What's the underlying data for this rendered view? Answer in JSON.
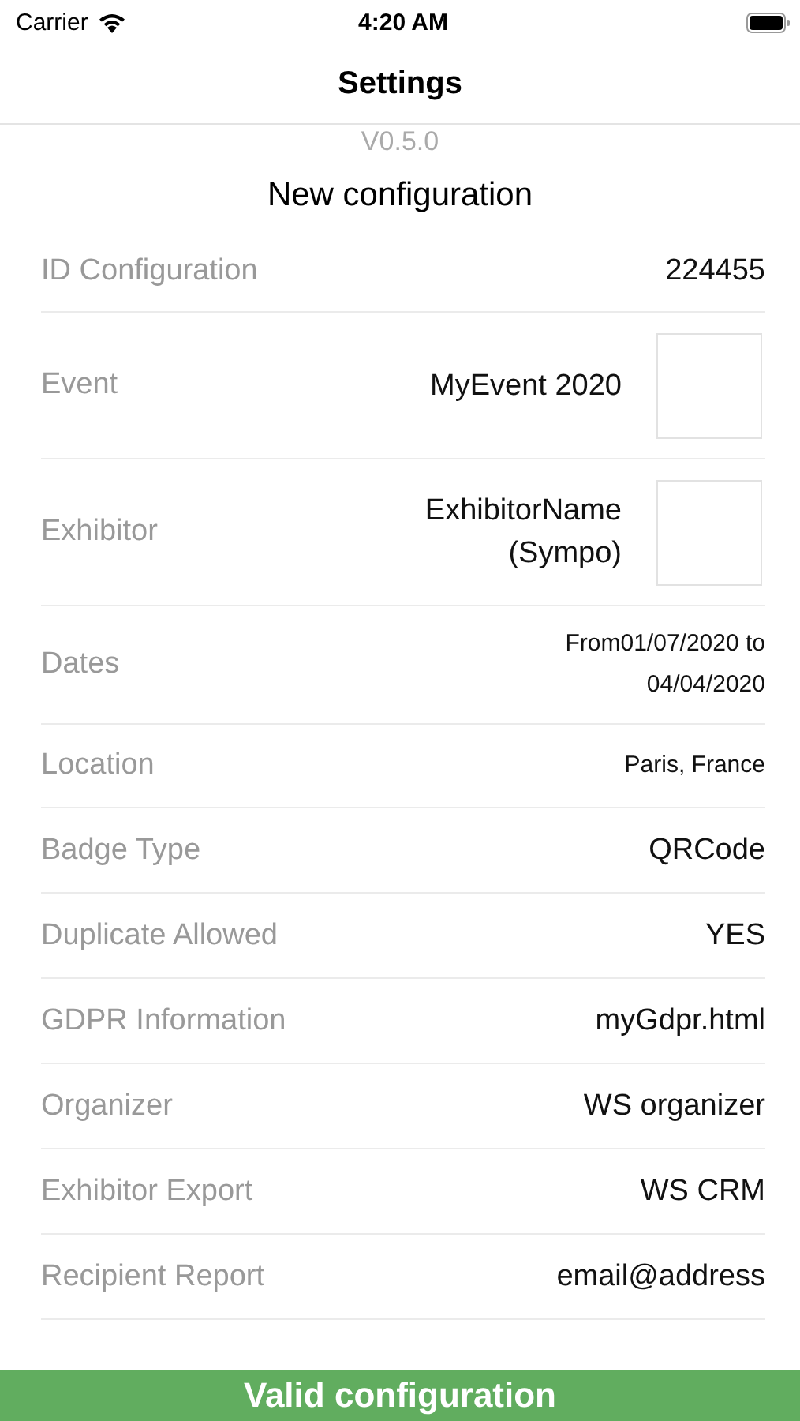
{
  "status_bar": {
    "carrier": "Carrier",
    "time": "4:20 AM"
  },
  "nav": {
    "title": "Settings"
  },
  "version": "V0.5.0",
  "section_title": "New configuration",
  "rows": [
    {
      "kind": "text",
      "label": "ID Configuration",
      "value": "224455"
    },
    {
      "kind": "image",
      "label": "Event",
      "value": "MyEvent 2020"
    },
    {
      "kind": "image",
      "label": "Exhibitor",
      "value": "ExhibitorName (Sympo)"
    },
    {
      "kind": "small",
      "label": "Dates",
      "value": "From01/07/2020 to 04/04/2020"
    },
    {
      "kind": "small",
      "label": "Location",
      "value": "Paris, France"
    },
    {
      "kind": "text",
      "label": "Badge Type",
      "value": "QRCode"
    },
    {
      "kind": "text",
      "label": "Duplicate Allowed",
      "value": "YES"
    },
    {
      "kind": "text",
      "label": "GDPR Information",
      "value": "myGdpr.html"
    },
    {
      "kind": "text",
      "label": "Organizer",
      "value": "WS organizer"
    },
    {
      "kind": "text",
      "label": "Exhibitor Export",
      "value": "WS CRM"
    },
    {
      "kind": "text",
      "label": "Recipient Report",
      "value": "email@address"
    }
  ],
  "button": {
    "label": "Valid configuration"
  }
}
